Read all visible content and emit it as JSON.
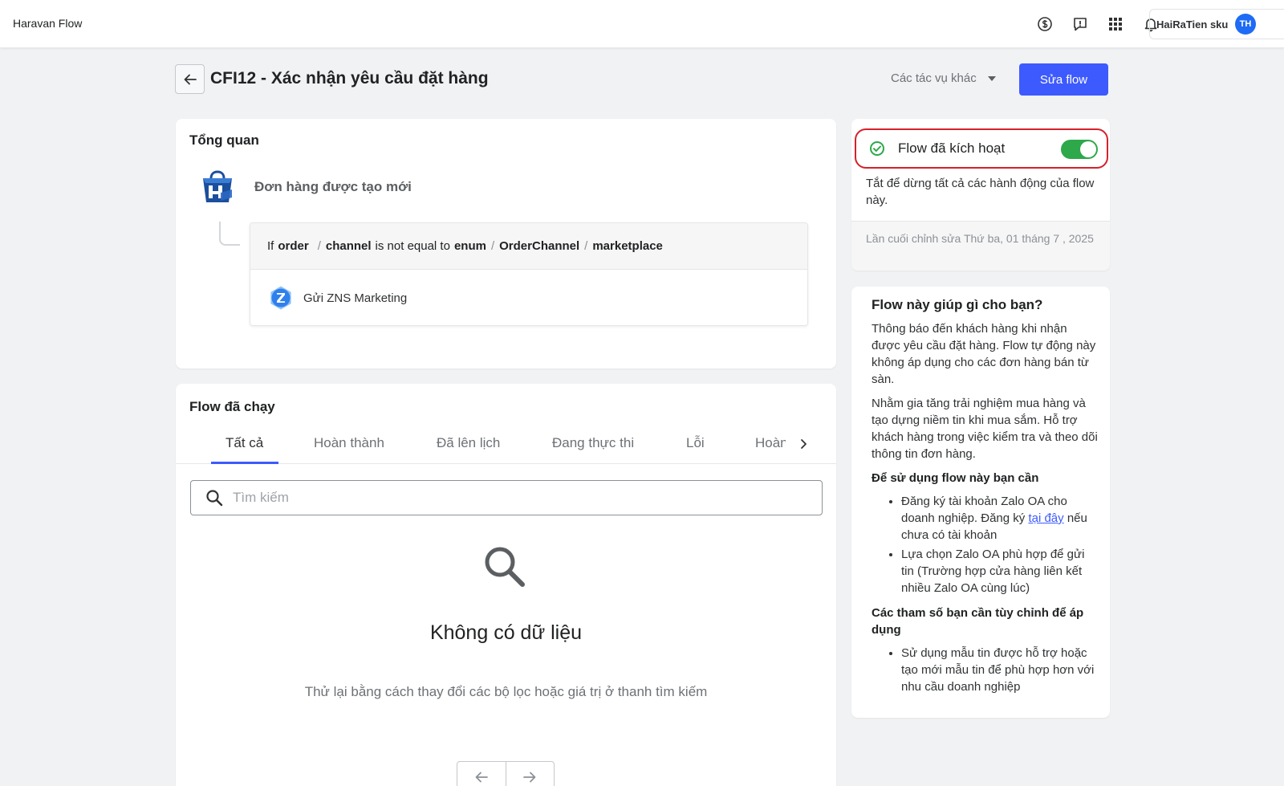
{
  "topbar": {
    "app_name": "Haravan Flow",
    "icons": [
      "billing-icon",
      "feedback-icon",
      "apps-grid-icon",
      "bell-icon"
    ],
    "user_name": "HaiRaTien sku",
    "avatar_initials": "TH"
  },
  "header": {
    "title": "CFI12 - Xác nhận yêu cầu đặt hàng",
    "more_actions_label": "Các tác vụ khác",
    "edit_button_label": "Sửa flow"
  },
  "overview": {
    "title": "Tổng quan",
    "trigger_label": "Đơn hàng được tạo mới",
    "condition": {
      "prefix": "If",
      "path": [
        "order",
        "channel"
      ],
      "operator": "is not equal to",
      "value_path": [
        "enum",
        "OrderChannel",
        "marketplace"
      ],
      "separator": "/"
    },
    "action_label": "Gửi ZNS Marketing"
  },
  "runs": {
    "title": "Flow đã chạy",
    "tabs": [
      "Tất cả",
      "Hoàn thành",
      "Đã lên lịch",
      "Đang thực thi",
      "Lỗi",
      "Hoàn t"
    ],
    "active_tab": "Tất cả",
    "search_placeholder": "Tìm kiếm",
    "empty_title": "Không có dữ liệu",
    "empty_subtitle": "Thử lại bằng cách thay đổi các bộ lọc hoặc giá trị ở thanh tìm kiếm"
  },
  "status": {
    "label": "Flow đã kích hoạt",
    "enabled": true,
    "description": "Tắt để dừng tất cả các hành động của flow này.",
    "last_edited": "Lần cuối chỉnh sửa Thứ ba, 01 tháng 7 , 2025"
  },
  "help": {
    "title": "Flow này giúp gì cho bạn?",
    "paragraph1": "Thông báo đến khách hàng khi nhận được yêu cầu đặt hàng. Flow tự động này không áp dụng cho các đơn hàng bán từ sàn.",
    "paragraph2": "Nhằm gia tăng trải nghiệm mua hàng và tạo dựng niềm tin khi mua sắm. Hỗ trợ khách hàng trong việc kiểm tra và theo dõi thông tin đơn hàng.",
    "requirements_title": "Để sử dụng flow này bạn cần",
    "req1_before": "Đăng ký tài khoản Zalo OA cho doanh nghiệp. Đăng ký ",
    "req1_link": "tại đây",
    "req1_after": " nếu chưa có tài khoản",
    "req2": "Lựa chọn Zalo OA phù hợp để gửi tin (Trường hợp cửa hàng liên kết nhiều Zalo OA cùng lúc)",
    "params_title": "Các tham số bạn cần tùy chỉnh để áp dụng",
    "param1": "Sử dụng mẫu tin được hỗ trợ hoặc tạo mới mẫu tin để phù hợp hơn với nhu cầu doanh nghiệp"
  },
  "colors": {
    "primary": "#3d5afe",
    "toggle_on": "#2da84a",
    "highlight_border": "#d6212b"
  }
}
